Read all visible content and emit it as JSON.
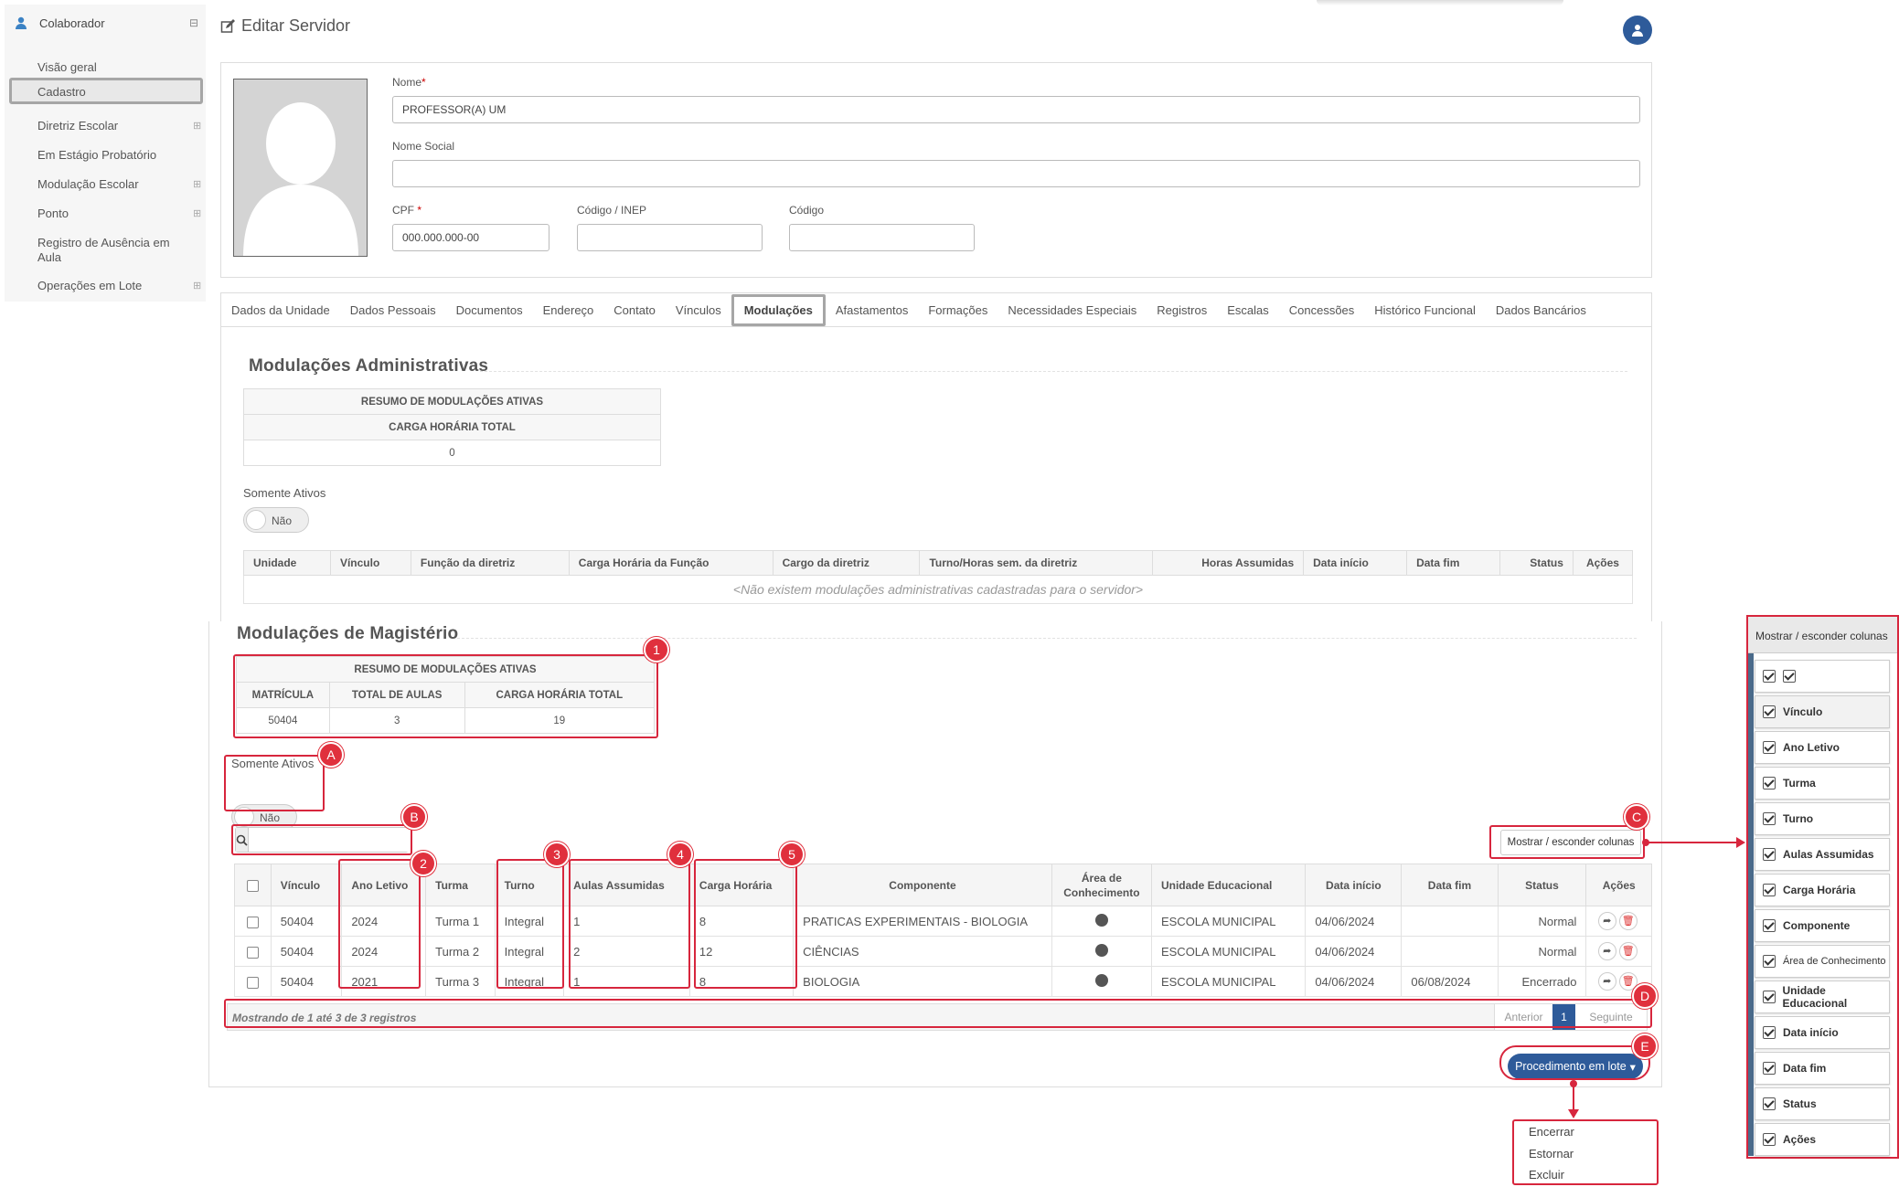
{
  "sidebar": {
    "header": "Colaborador",
    "items": [
      {
        "label": "Visão geral",
        "expandable": false
      },
      {
        "label": "Cadastro",
        "expandable": false,
        "active": true
      },
      {
        "label": "Diretriz Escolar",
        "expandable": true
      },
      {
        "label": "Em Estágio Probatório",
        "expandable": false
      },
      {
        "label": "Modulação Escolar",
        "expandable": true
      },
      {
        "label": "Ponto",
        "expandable": true
      },
      {
        "label": "Registro de Ausência em",
        "label2": "Aula",
        "expandable": false
      },
      {
        "label": "Operações em Lote",
        "expandable": true
      }
    ]
  },
  "page": {
    "title": "Editar Servidor"
  },
  "form": {
    "nome_label": "Nome",
    "nome_value": "PROFESSOR(A) UM",
    "nome_social_label": "Nome Social",
    "nome_social_value": "",
    "cpf_label": "CPF",
    "cpf_value": "000.000.000-00",
    "inep_label": "Código / INEP",
    "inep_value": "",
    "codigo_label": "Código",
    "codigo_value": "",
    "required_mark": "*"
  },
  "tabs": [
    "Dados da Unidade",
    "Dados Pessoais",
    "Documentos",
    "Endereço",
    "Contato",
    "Vínculos",
    "Modulações",
    "Afastamentos",
    "Formações",
    "Necessidades Especiais",
    "Registros",
    "Escalas",
    "Concessões",
    "Histórico Funcional",
    "Dados Bancários"
  ],
  "active_tab": "Modulações",
  "admin": {
    "title": "Modulações Administrativas",
    "summary_title": "RESUMO DE MODULAÇÕES ATIVAS",
    "summary_col": "CARGA HORÁRIA TOTAL",
    "summary_value": "0",
    "only_active_label": "Somente Ativos",
    "toggle_text": "Não",
    "columns": [
      "Unidade",
      "Vínculo",
      "Função da diretriz",
      "Carga Horária da Função",
      "Cargo da diretriz",
      "Turno/Horas sem. da diretriz",
      "Horas Assumidas",
      "Data início",
      "Data fim",
      "Status",
      "Ações"
    ],
    "empty": "<Não existem modulações administrativas cadastradas para o servidor>"
  },
  "magisterio": {
    "title": "Modulações de Magistério",
    "summary_title": "RESUMO DE MODULAÇÕES ATIVAS",
    "summary_cols": [
      "MATRÍCULA",
      "TOTAL DE AULAS",
      "CARGA HORÁRIA TOTAL"
    ],
    "summary_values": [
      "50404",
      "3",
      "19"
    ],
    "only_active_label": "Somente Ativos",
    "toggle_text": "Não",
    "show_hide_label": "Mostrar / esconder colunas",
    "columns": [
      "Vínculo",
      "Ano Letivo",
      "Turma",
      "Turno",
      "Aulas Assumidas",
      "Carga Horária",
      "Componente",
      "Área de",
      "Conhecimento",
      "Unidade Educacional",
      "Data início",
      "Data fim",
      "Status",
      "Ações"
    ],
    "rows": [
      [
        "50404",
        "2024",
        "Turma 1",
        "Integral",
        "1",
        "8",
        "PRATICAS EXPERIMENTAIS - BIOLOGIA",
        "ESCOLA MUNICIPAL",
        "04/06/2024",
        "",
        "Normal"
      ],
      [
        "50404",
        "2024",
        "Turma 2",
        "Integral",
        "2",
        "12",
        "CIÊNCIAS",
        "ESCOLA MUNICIPAL",
        "04/06/2024",
        "",
        "Normal"
      ],
      [
        "50404",
        "2021",
        "Turma 3",
        "Integral",
        "1",
        "8",
        "BIOLOGIA",
        "ESCOLA MUNICIPAL",
        "04/06/2024",
        "06/08/2024",
        "Encerrado"
      ]
    ],
    "footer": "Mostrando de 1 até 3 de 3 registros",
    "prev": "Anterior",
    "page": "1",
    "next": "Seguinte",
    "batch_button": "Procedimento em lote",
    "batch_menu": [
      "Encerrar",
      "Estornar",
      "Excluir"
    ]
  },
  "badges": [
    "1",
    "A",
    "B",
    "C",
    "2",
    "3",
    "4",
    "5",
    "D",
    "E"
  ],
  "column_panel": {
    "title": "Mostrar / esconder colunas",
    "items": [
      "",
      "Vínculo",
      "Ano Letivo",
      "Turma",
      "Turno",
      "Aulas Assumidas",
      "Carga Horária",
      "Componente",
      "Área de Conhecimento",
      "Unidade Educacional",
      "Data início",
      "Data fim",
      "Status",
      "Ações"
    ]
  },
  "colors": {
    "accent": "#2e5b9a",
    "annotation": "#d7263d"
  },
  "icons": {
    "user": "user-icon",
    "edit": "edit-icon",
    "search": "search-icon",
    "forward": "share-icon",
    "delete": "trash-icon"
  }
}
